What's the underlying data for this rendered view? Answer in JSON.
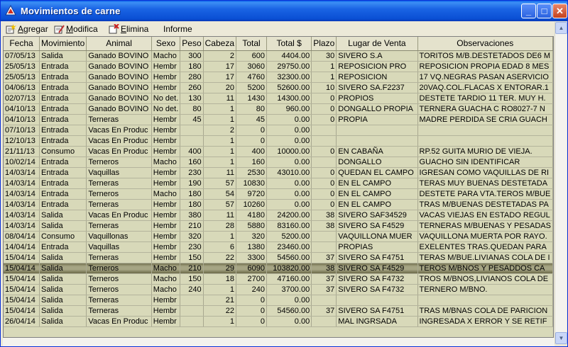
{
  "window": {
    "title": "Movimientos de carne"
  },
  "menu": {
    "agrega": {
      "first": "A",
      "rest": "gregar"
    },
    "modifica": {
      "first": "M",
      "rest": "odifica"
    },
    "elimina": {
      "first": "E",
      "rest": "limina"
    },
    "informe": "Informe"
  },
  "columns": [
    "Fecha",
    "Movimiento",
    "Animal",
    "Sexo",
    "Peso",
    "Cabeza",
    "Total",
    "Total $",
    "Plazo",
    "Lugar de Venta",
    "Observaciones"
  ],
  "rows": [
    [
      "07/05/13",
      "Salida",
      "Ganado BOVINO",
      "Macho",
      "300",
      "2",
      "600",
      "4404.00",
      "30",
      "SIVERO S.A",
      "TORITOS M/B.DESTETADOS DE6 M"
    ],
    [
      "25/05/13",
      "Entrada",
      "Ganado BOVINO",
      "Hembr",
      "180",
      "17",
      "3060",
      "29750.00",
      "1",
      "REPOSICION PRO",
      "REPOSICION PROPIA EDAD 8 MES"
    ],
    [
      "25/05/13",
      "Entrada",
      "Ganado BOVINO",
      "Hembr",
      "280",
      "17",
      "4760",
      "32300.00",
      "1",
      "REPOSICION",
      "17 VQ.NEGRAS PASAN ASERVICIO"
    ],
    [
      "04/06/13",
      "Entrada",
      "Ganado BOVINO",
      "Hembr",
      "260",
      "20",
      "5200",
      "52600.00",
      "10",
      "SIVERO SA.F2237",
      "20VAQ.COL.FLACAS X ENTORAR.1"
    ],
    [
      "02/07/13",
      "Entrada",
      "Ganado BOVINO",
      "No det.",
      "130",
      "11",
      "1430",
      "14300.00",
      "0",
      "PROPIOS",
      "DESTETE TARDIO 11 TER. MUY H."
    ],
    [
      "04/10/13",
      "Entrada",
      "Ganado BOVINO",
      "No det.",
      "80",
      "1",
      "80",
      "960.00",
      "0",
      "DONGALLO PROPIA",
      "TERNERA GUACHA C RO8027-7 N"
    ],
    [
      "04/10/13",
      "Entrada",
      "Terneras",
      "Hembr",
      "45",
      "1",
      "45",
      "0.00",
      "0",
      "PROPIA",
      "MADRE PERDIDA SE CRIA GUACH"
    ],
    [
      "07/10/13",
      "Entrada",
      "Vacas En Produc",
      "Hembr",
      "",
      "2",
      "0",
      "0.00",
      "",
      "",
      ""
    ],
    [
      "12/10/13",
      "Entrada",
      "Vacas En Produc",
      "Hembr",
      "",
      "1",
      "0",
      "0.00",
      "",
      "",
      ""
    ],
    [
      "21/11/13",
      "Consumo",
      "Vacas En Produc",
      "Hembr",
      "400",
      "1",
      "400",
      "10000.00",
      "0",
      "EN CABAÑA",
      "RP.52 GUITA MURIO DE VIEJA."
    ],
    [
      "10/02/14",
      "Entrada",
      "Terneros",
      "Macho",
      "160",
      "1",
      "160",
      "0.00",
      "",
      "DONGALLO",
      "GUACHO SIN IDENTIFICAR"
    ],
    [
      "14/03/14",
      "Entrada",
      "Vaquillas",
      "Hembr",
      "230",
      "11",
      "2530",
      "43010.00",
      "0",
      "QUEDAN EL CAMPO",
      "IGRESAN COMO VAQUILLAS DE RI"
    ],
    [
      "14/03/14",
      "Entrada",
      "Terneras",
      "Hembr",
      "190",
      "57",
      "10830",
      "0.00",
      "0",
      "EN EL CAMPO",
      "TERAS MUY BUENAS DESTETADA"
    ],
    [
      "14/03/14",
      "Entrada",
      "Terneros",
      "Macho",
      "180",
      "54",
      "9720",
      "0.00",
      "0",
      "EN EL CAMPO",
      "DESTETE PARA VTA.TEROS M/BUE"
    ],
    [
      "14/03/14",
      "Entrada",
      "Terneras",
      "Hembr",
      "180",
      "57",
      "10260",
      "0.00",
      "0",
      "EN EL CAMPO",
      "TRAS M/BUENAS DESTETADAS PA"
    ],
    [
      "14/03/14",
      "Salida",
      "Vacas En Produc",
      "Hembr",
      "380",
      "11",
      "4180",
      "24200.00",
      "38",
      "SIVERO SAF34529",
      "VACAS VIEJAS EN ESTADO REGUL"
    ],
    [
      "14/03/14",
      "Salida",
      "Terneras",
      "Hembr",
      "210",
      "28",
      "5880",
      "83160.00",
      "38",
      "SIVERO SA F4529",
      "TERNERAS M/BUENAS Y PESADAS"
    ],
    [
      "08/04/14",
      "Consumo",
      "Vaquillonas",
      "Hembr",
      "320",
      "1",
      "320",
      "5200.00",
      "",
      "VAQUILLONA MUER",
      "VAQUILLONA MUERTA POR RAYO."
    ],
    [
      "14/04/14",
      "Entrada",
      "Vaquillas",
      "Hembr",
      "230",
      "6",
      "1380",
      "23460.00",
      "",
      "PROPIAS",
      "EXELENTES TRAS.QUEDAN PARA"
    ],
    [
      "15/04/14",
      "Salida",
      "Terneras",
      "Hembr",
      "150",
      "22",
      "3300",
      "54560.00",
      "37",
      "SIVERO SA F4751",
      "TERAS M/BUE.LIVIANAS COLA DE I"
    ],
    [
      "15/04/14",
      "Salida",
      "Terneros",
      "Macho",
      "210",
      "29",
      "6090",
      "103820.00",
      "38",
      "SIVERO SA F4529",
      "TEROS M/BNOS Y PESADDOS CA"
    ],
    [
      "15/04/14",
      "Salida",
      "Terneros",
      "Macho",
      "150",
      "18",
      "2700",
      "47160.00",
      "37",
      "SIVERO SA F4732",
      "TROS M/BNOS,LIVIANOS COLA DE"
    ],
    [
      "15/04/14",
      "Salida",
      "Terneros",
      "Macho",
      "240",
      "1",
      "240",
      "3700.00",
      "37",
      "SIVERO SA F4732",
      "TERNERO M/BNO."
    ],
    [
      "15/04/14",
      "Salida",
      "Terneras",
      "Hembr",
      "",
      "21",
      "0",
      "0.00",
      "",
      "",
      ""
    ],
    [
      "15/04/14",
      "Salida",
      "Terneras",
      "Hembr",
      "",
      "22",
      "0",
      "54560.00",
      "37",
      "SIVERO SA F4751",
      "TRAS M/BNAS COLA DE PARICION"
    ],
    [
      "26/04/14",
      "Salida",
      "Vacas En Produc",
      "Hembr",
      "",
      "1",
      "0",
      "0.00",
      "",
      "MAL INGRSADA",
      "INGRESADA X ERROR Y SE RETIF"
    ]
  ],
  "selected_row": 20,
  "colors": {
    "grid_bg": "#d8d9b9",
    "selection": "#a6a584",
    "titlebar": "#0a4fd4"
  }
}
